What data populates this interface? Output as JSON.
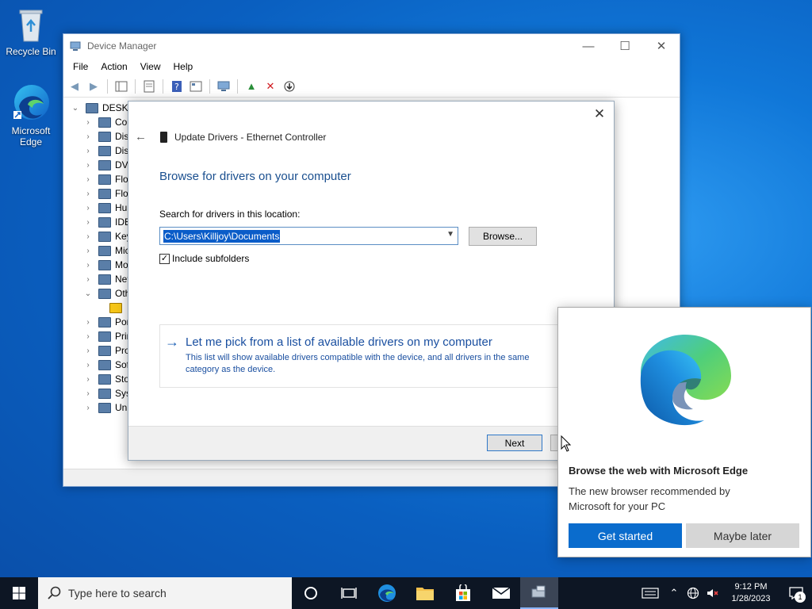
{
  "desktop": {
    "recycle_bin": "Recycle Bin",
    "edge_line1": "Microsoft",
    "edge_line2": "Edge"
  },
  "device_manager": {
    "title": "Device Manager",
    "menu": [
      "File",
      "Action",
      "View",
      "Help"
    ],
    "tree_root": "DESKTO",
    "tree_items": [
      "Cor",
      "Disl",
      "Disp",
      "DVD",
      "Flop",
      "Flop",
      "Hun",
      "IDE",
      "Key",
      "Mic",
      "Mo",
      "Net",
      "Oth",
      "",
      "Por",
      "Prir",
      "Pro",
      "Sof",
      "Sto",
      "Syst",
      "Uni"
    ]
  },
  "update_drivers": {
    "header": "Update Drivers - Ethernet Controller",
    "heading": "Browse for drivers on your computer",
    "search_label": "Search for drivers in this location:",
    "path_value": "C:\\Users\\Killjoy\\Documents",
    "browse_label": "Browse...",
    "include_subfolders": "Include subfolders",
    "include_checked": "✓",
    "pick_title": "Let me pick from a list of available drivers on my computer",
    "pick_desc": "This list will show available drivers compatible with the device, and all drivers in the same category as the device.",
    "next_label": "Next"
  },
  "edge_popup": {
    "title": "Browse the web with Microsoft Edge",
    "description": "The new browser recommended by Microsoft for your PC",
    "get_started": "Get started",
    "maybe_later": "Maybe later"
  },
  "taskbar": {
    "search_placeholder": "Type here to search",
    "time": "9:12 PM",
    "date": "1/28/2023",
    "notification_count": "1"
  },
  "colors": {
    "accent": "#0a6ccd",
    "desktop": "#1077d8",
    "link": "#1a4fa0"
  }
}
